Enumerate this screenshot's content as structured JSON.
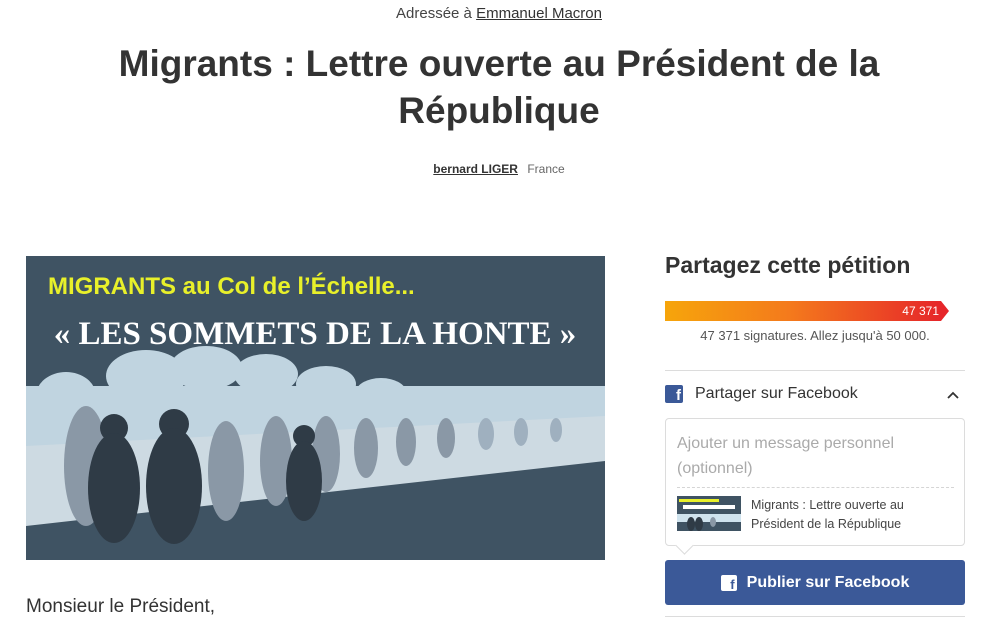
{
  "header": {
    "addressed_prefix": "Adressée à",
    "addressed_target": "Emmanuel Macron",
    "title": "Migrants : Lettre ouverte au Président de la République",
    "author": "bernard LIGER",
    "country": "France"
  },
  "hero": {
    "headline": "MIGRANTS au Col de l’Échelle...",
    "subheadline": "« LES SOMMETS DE LA HONTE »"
  },
  "body": {
    "salutation": "Monsieur le Président,"
  },
  "share": {
    "title": "Partagez cette pétition",
    "progress_count": "47 371",
    "progress_fraction": 0.947,
    "signatures_text": "47 371 signatures. Allez jusqu'à 50 000.",
    "facebook_label": "Partager sur Facebook",
    "message_placeholder": "Ajouter un message personnel (optionnel)",
    "preview_title": "Migrants : Lettre ouverte au Président de la République",
    "publish_label": "Publier sur Facebook"
  },
  "colors": {
    "facebook": "#3b5998",
    "progress_start": "#f6a50b",
    "progress_end": "#e6262a",
    "hero_bg": "#3f5363",
    "hero_headline": "#e8f02a"
  },
  "icons": [
    "facebook-icon",
    "chevron-up-icon"
  ]
}
